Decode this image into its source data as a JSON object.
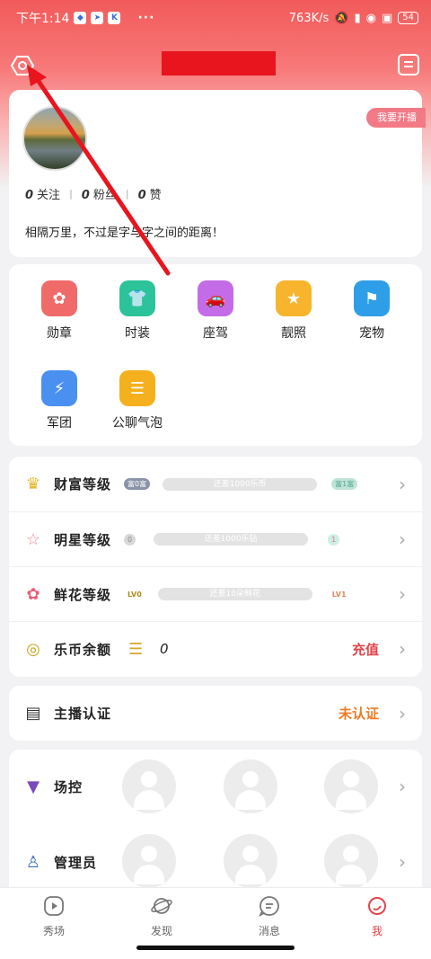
{
  "status_bar": {
    "time": "下午1:14",
    "dots": "···",
    "network_speed": "763K/s",
    "battery": "54"
  },
  "header": {
    "title": ""
  },
  "profile": {
    "anchor_button": "我要开播",
    "stats": [
      {
        "value": "0",
        "label": "关注"
      },
      {
        "value": "0",
        "label": "粉丝"
      },
      {
        "value": "0",
        "label": "赞"
      }
    ],
    "bio": "相隔万里，不过是字与字之间的距离！"
  },
  "features": [
    {
      "label": "勋章",
      "icon": "medal-icon",
      "color": "#f06a6a"
    },
    {
      "label": "时装",
      "icon": "clothing-icon",
      "color": "#2dc39a"
    },
    {
      "label": "座驾",
      "icon": "car-icon",
      "color": "#c46be8"
    },
    {
      "label": "靓照",
      "icon": "star-photo-icon",
      "color": "#f7b42c"
    },
    {
      "label": "宠物",
      "icon": "pet-icon",
      "color": "#2f9ee8"
    },
    {
      "label": "军团",
      "icon": "shield-icon",
      "color": "#4a90f0"
    },
    {
      "label": "公聊气泡",
      "icon": "chat-bubble-icon",
      "color": "#f5b01e"
    }
  ],
  "levels": {
    "wealth": {
      "title": "财富等级",
      "current_badge": "富0富",
      "progress_text": "还差1000乐币",
      "next_badge": "富1富",
      "progress": 0
    },
    "star": {
      "title": "明星等级",
      "current_badge": "0",
      "progress_text": "还差1000乐钻",
      "next_badge": "1",
      "progress": 0
    },
    "flower": {
      "title": "鲜花等级",
      "current_badge": "LV0",
      "progress_text": "还差10朵鲜花",
      "next_badge": "LV1",
      "progress": 0
    },
    "balance": {
      "title": "乐币余额",
      "value": "0",
      "action": "充值"
    }
  },
  "verification": {
    "title": "主播认证",
    "status": "未认证"
  },
  "admin": {
    "field_control": "场控",
    "administrator": "管理员"
  },
  "bottom_nav": [
    {
      "label": "秀场"
    },
    {
      "label": "发现"
    },
    {
      "label": "消息"
    },
    {
      "label": "我",
      "active": true
    }
  ],
  "colors": {
    "brand_red": "#e5434b",
    "header_gradient_top": "#f25a5a",
    "annotation_red": "#e8151e",
    "warning_orange": "#f07a24"
  }
}
